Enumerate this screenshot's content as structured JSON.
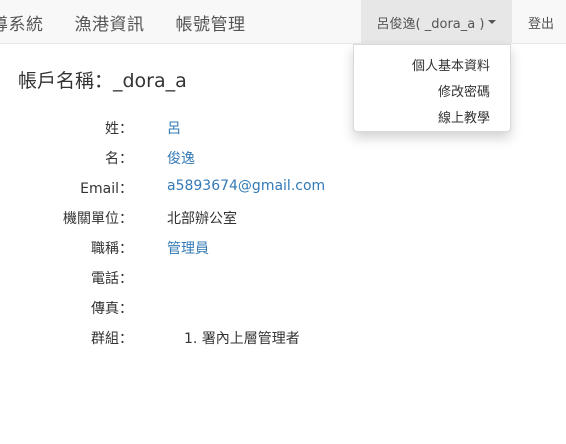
{
  "nav": {
    "items": [
      "導系統",
      "漁港資訊",
      "帳號管理"
    ],
    "user_menu_label": "呂俊逸( _dora_a )",
    "logout_label": "登出",
    "dropdown": [
      "個人基本資料",
      "修改密碼",
      "線上教學"
    ]
  },
  "page": {
    "title": "帳戶名稱：_dora_a"
  },
  "profile": {
    "fields": [
      {
        "label": "姓：",
        "value": "呂"
      },
      {
        "label": "名：",
        "value": "俊逸"
      },
      {
        "label": "Email：",
        "value": "a5893674@gmail.com"
      },
      {
        "label": "機關單位：",
        "value": "北部辦公室"
      },
      {
        "label": "職稱：",
        "value": "管理員"
      },
      {
        "label": "電話：",
        "value": ""
      },
      {
        "label": "傳真：",
        "value": ""
      },
      {
        "label": "群組：",
        "value": ""
      }
    ],
    "groups": [
      {
        "number": "1.",
        "name": "署內上層管理者"
      }
    ]
  },
  "colors": {
    "link": "#337ab7",
    "navbar_bg": "#f8f8f8",
    "active_menu_bg": "#e7e7e7"
  }
}
